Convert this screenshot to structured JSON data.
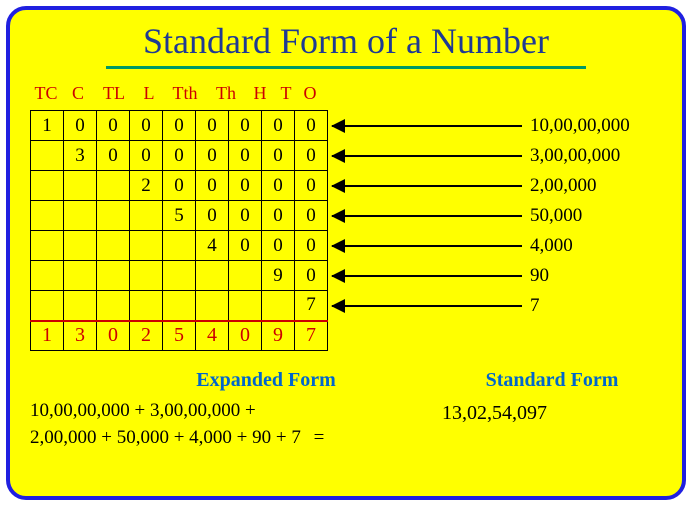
{
  "title": "Standard Form of a Number",
  "headers": {
    "tc": "TC",
    "c": "C",
    "tl": "TL",
    "l": "L",
    "tth": "Tth",
    "th": "Th",
    "h": "H",
    "t": "T",
    "o": "O"
  },
  "rows": [
    [
      "1",
      "0",
      "0",
      "0",
      "0",
      "0",
      "0",
      "0",
      "0"
    ],
    [
      "",
      "3",
      "0",
      "0",
      "0",
      "0",
      "0",
      "0",
      "0"
    ],
    [
      "",
      "",
      "",
      "2",
      "0",
      "0",
      "0",
      "0",
      "0"
    ],
    [
      "",
      "",
      "",
      "",
      "5",
      "0",
      "0",
      "0",
      "0"
    ],
    [
      "",
      "",
      "",
      "",
      "",
      "4",
      "0",
      "0",
      "0"
    ],
    [
      "",
      "",
      "",
      "",
      "",
      "",
      "",
      "9",
      "0"
    ],
    [
      "",
      "",
      "",
      "",
      "",
      "",
      "",
      "",
      "7"
    ]
  ],
  "sum_row": [
    "1",
    "3",
    "0",
    "2",
    "5",
    "4",
    "0",
    "9",
    "7"
  ],
  "values": [
    "10,00,00,000",
    "3,00,00,000",
    "2,00,000",
    "50,000",
    "4,000",
    "90",
    "7"
  ],
  "labels": {
    "expanded": "Expanded Form",
    "standard": "Standard Form"
  },
  "expanded_line1": "10,00,00,000 + 3,00,00,000 +",
  "expanded_line2": "2,00,000 + 50,000 + 4,000 + 90 + 7",
  "equals": "=",
  "standard_value": "13,02,54,097",
  "chart_data": {
    "type": "table",
    "title": "Standard Form of a Number",
    "columns": [
      "TC",
      "C",
      "TL",
      "L",
      "Tth",
      "Th",
      "H",
      "T",
      "O"
    ],
    "place_value_rows": [
      {
        "digits": [
          1,
          0,
          0,
          0,
          0,
          0,
          0,
          0,
          0
        ],
        "value": "10,00,00,000"
      },
      {
        "digits": [
          null,
          3,
          0,
          0,
          0,
          0,
          0,
          0,
          0
        ],
        "value": "3,00,00,000"
      },
      {
        "digits": [
          null,
          null,
          null,
          2,
          0,
          0,
          0,
          0,
          0
        ],
        "value": "2,00,000"
      },
      {
        "digits": [
          null,
          null,
          null,
          null,
          5,
          0,
          0,
          0,
          0
        ],
        "value": "50,000"
      },
      {
        "digits": [
          null,
          null,
          null,
          null,
          null,
          4,
          0,
          0,
          0
        ],
        "value": "4,000"
      },
      {
        "digits": [
          null,
          null,
          null,
          null,
          null,
          null,
          null,
          9,
          0
        ],
        "value": "90"
      },
      {
        "digits": [
          null,
          null,
          null,
          null,
          null,
          null,
          null,
          null,
          7
        ],
        "value": "7"
      }
    ],
    "sum_digits": [
      1,
      3,
      0,
      2,
      5,
      4,
      0,
      9,
      7
    ],
    "expanded_form": "10,00,00,000 + 3,00,00,000 + 2,00,000 + 50,000 + 4,000 + 90 + 7",
    "standard_form": "13,02,54,097"
  }
}
